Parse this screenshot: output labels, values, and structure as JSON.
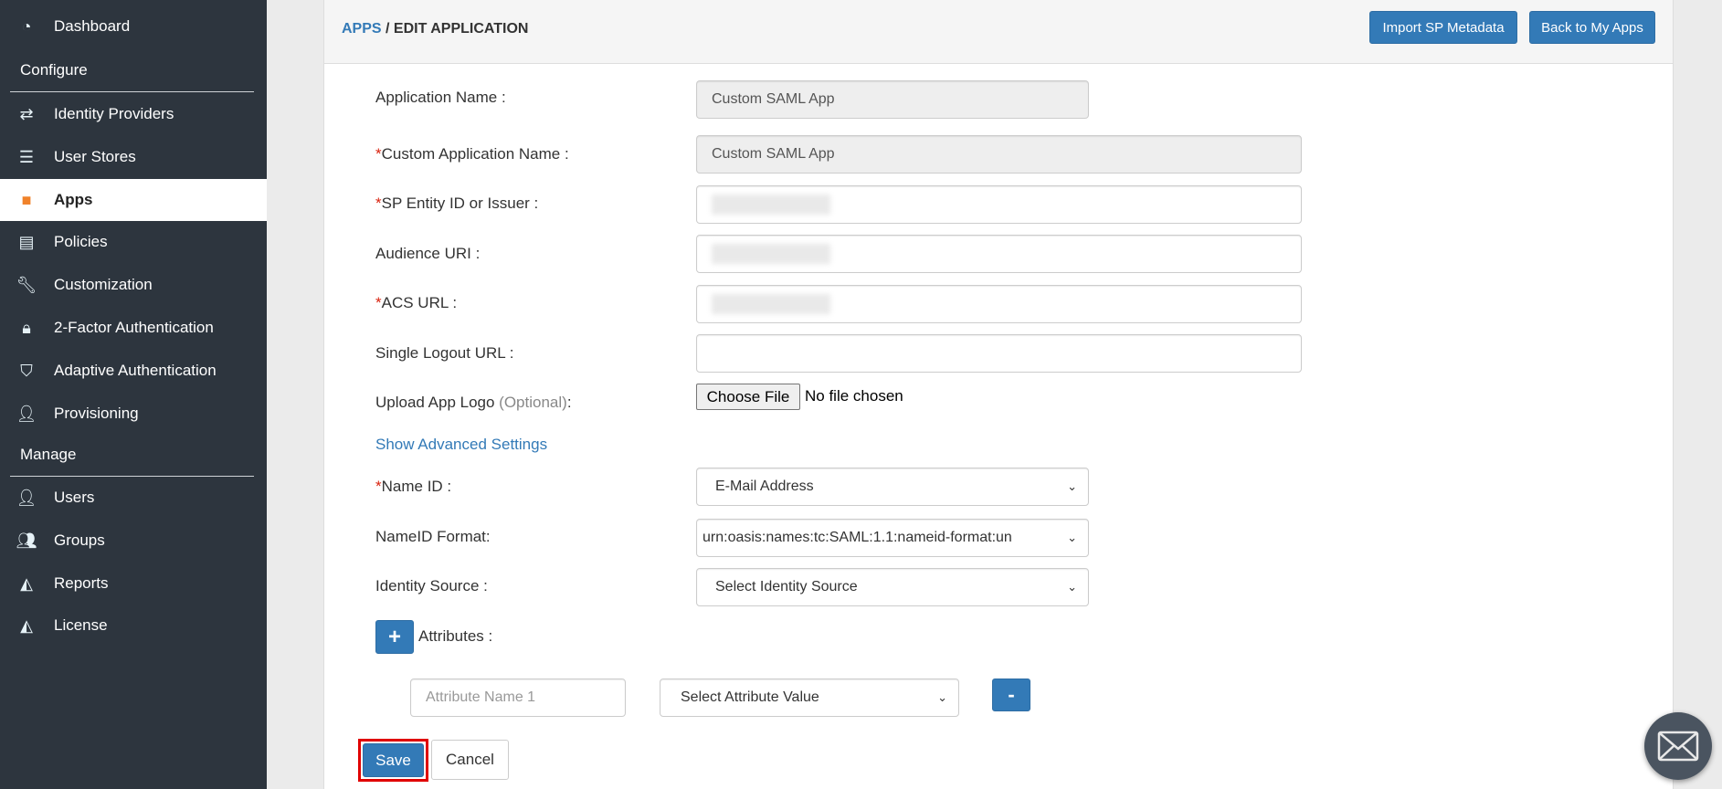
{
  "sidebar": {
    "items": [
      {
        "label": "Dashboard",
        "icon": "dashboard-icon"
      },
      {
        "label": "Identity Providers",
        "icon": "exchange-icon"
      },
      {
        "label": "User Stores",
        "icon": "database-icon"
      },
      {
        "label": "Apps",
        "icon": "cube-icon",
        "active": true
      },
      {
        "label": "Policies",
        "icon": "document-icon"
      },
      {
        "label": "Customization",
        "icon": "wrench-icon"
      },
      {
        "label": "2-Factor Authentication",
        "icon": "lock-icon"
      },
      {
        "label": "Adaptive Authentication",
        "icon": "shield-icon"
      },
      {
        "label": "Provisioning",
        "icon": "user-icon"
      },
      {
        "label": "Users",
        "icon": "user-icon"
      },
      {
        "label": "Groups",
        "icon": "users-icon"
      },
      {
        "label": "Reports",
        "icon": "area-chart-icon"
      },
      {
        "label": "License",
        "icon": "area-chart-icon"
      }
    ],
    "sections": {
      "configure": "Configure",
      "manage": "Manage"
    }
  },
  "header": {
    "breadcrumb_link": "APPS",
    "breadcrumb_sep": " / ",
    "breadcrumb_current": "EDIT APPLICATION",
    "import_button": "Import SP Metadata",
    "back_button": "Back to My Apps"
  },
  "form": {
    "app_name_label": "Application Name :",
    "app_name_value": "Custom SAML App",
    "custom_name_label": "Custom Application Name :",
    "custom_name_value": "Custom SAML App",
    "sp_entity_label": "SP Entity ID or Issuer :",
    "audience_label": "Audience URI :",
    "acs_label": "ACS URL :",
    "slo_label": "Single Logout URL :",
    "logo_label": "Upload App Logo ",
    "logo_optional": "(Optional)",
    "logo_colon": ":",
    "choose_file": "Choose File",
    "no_file": "No file chosen",
    "advanced_link": "Show Advanced Settings",
    "name_id_label": "Name ID :",
    "name_id_value": "E-Mail Address",
    "nameid_format_label": "NameID Format:",
    "nameid_format_value": "urn:oasis:names:tc:SAML:1.1:nameid-format:un",
    "identity_source_label": "Identity Source :",
    "identity_source_value": "Select Identity Source",
    "attributes_label": "Attributes :",
    "attr_name_placeholder": "Attribute Name 1",
    "attr_value_select": "Select Attribute Value",
    "required_mark": "*",
    "save": "Save",
    "cancel": "Cancel"
  },
  "colors": {
    "sidebar_bg": "#2d353e",
    "primary": "#337ab7",
    "active_icon": "#f0822a",
    "highlight": "#e00000"
  }
}
